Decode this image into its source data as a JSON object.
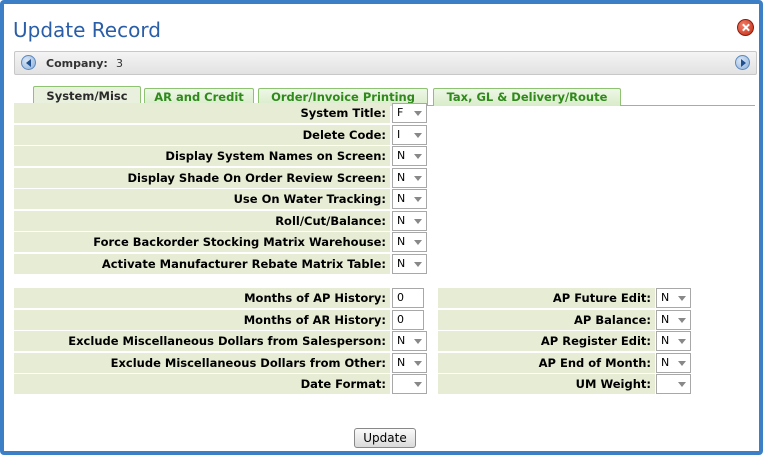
{
  "dialog": {
    "title": "Update Record",
    "close_label": ""
  },
  "company": {
    "label": "Company:",
    "value": "3"
  },
  "tabs": [
    {
      "label": "System/Misc",
      "active": true
    },
    {
      "label": "AR and Credit",
      "active": false
    },
    {
      "label": "Order/Invoice Printing",
      "active": false
    },
    {
      "label": "Tax, GL & Delivery/Route",
      "active": false
    }
  ],
  "section1": {
    "rows": [
      {
        "label": "System Title:",
        "value": "F"
      },
      {
        "label": "Delete Code:",
        "value": "I"
      },
      {
        "label": "Display System Names on Screen:",
        "value": "N"
      },
      {
        "label": "Display Shade On Order Review Screen:",
        "value": "N"
      },
      {
        "label": "Use On Water Tracking:",
        "value": "N"
      },
      {
        "label": "Roll/Cut/Balance:",
        "value": "N"
      },
      {
        "label": "Force Backorder Stocking Matrix Warehouse:",
        "value": "N"
      },
      {
        "label": "Activate Manufacturer Rebate Matrix Table:",
        "value": "N"
      }
    ]
  },
  "section2": {
    "left": [
      {
        "label": "Months of AP History:",
        "value": "0",
        "kind": "text"
      },
      {
        "label": "Months of AR History:",
        "value": "0",
        "kind": "text"
      },
      {
        "label": "Exclude Miscellaneous Dollars from Salesperson:",
        "value": "N",
        "kind": "select"
      },
      {
        "label": "Exclude Miscellaneous Dollars from Other:",
        "value": "N",
        "kind": "select"
      },
      {
        "label": "Date Format:",
        "value": "",
        "kind": "select"
      }
    ],
    "right": [
      {
        "label": "AP Future Edit:",
        "value": "N"
      },
      {
        "label": "AP Balance:",
        "value": "N"
      },
      {
        "label": "AP Register Edit:",
        "value": "N"
      },
      {
        "label": "AP End of Month:",
        "value": "N"
      },
      {
        "label": "UM Weight:",
        "value": ""
      }
    ]
  },
  "actions": {
    "update_label": "Update"
  },
  "colors": {
    "accent": "#3d7fc6",
    "tab_green": "#2f8a1b",
    "row_bg": "#e7ecd5",
    "close_red": "#c42a12"
  }
}
